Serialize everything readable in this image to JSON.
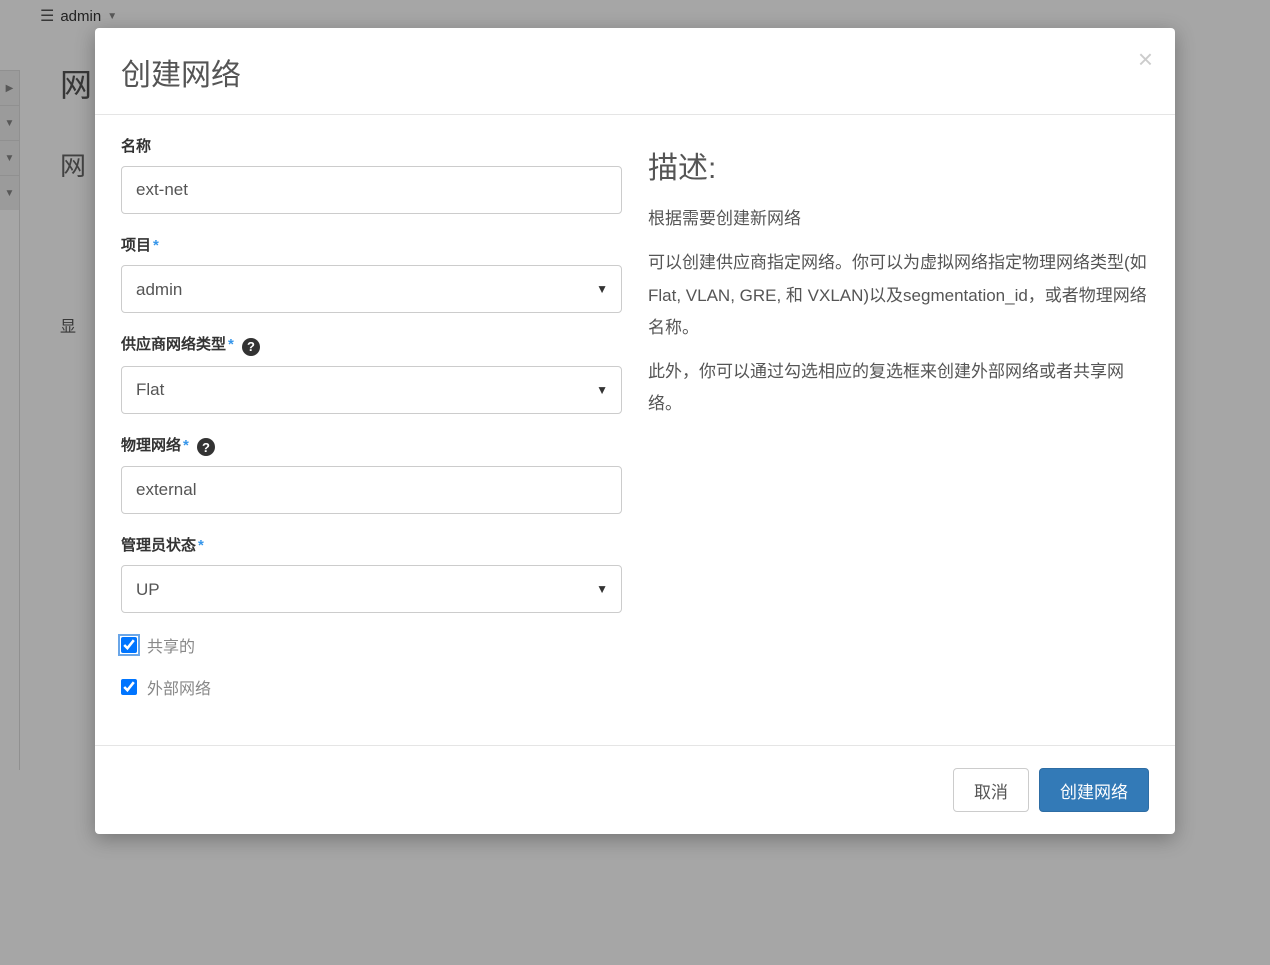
{
  "header": {
    "project_name": "admin"
  },
  "bg": {
    "page_title_partial": "网",
    "sub_title_partial": "网",
    "row_label_partial": "显"
  },
  "modal": {
    "title": "创建网络",
    "labels": {
      "name": "名称",
      "project": "项目",
      "provider_network_type": "供应商网络类型",
      "physical_network": "物理网络",
      "admin_state": "管理员状态",
      "shared": "共享的",
      "external_network": "外部网络"
    },
    "values": {
      "name": "ext-net",
      "project": "admin",
      "provider_network_type": "Flat",
      "physical_network": "external",
      "admin_state": "UP",
      "shared": true,
      "external_network": true
    },
    "description": {
      "title": "描述:",
      "p1": "根据需要创建新网络",
      "p2": "可以创建供应商指定网络。你可以为虚拟网络指定物理网络类型(如Flat, VLAN, GRE, 和 VXLAN)以及segmentation_id，或者物理网络名称。",
      "p3": "此外，你可以通过勾选相应的复选框来创建外部网络或者共享网络。"
    },
    "footer": {
      "cancel": "取消",
      "submit": "创建网络"
    }
  }
}
